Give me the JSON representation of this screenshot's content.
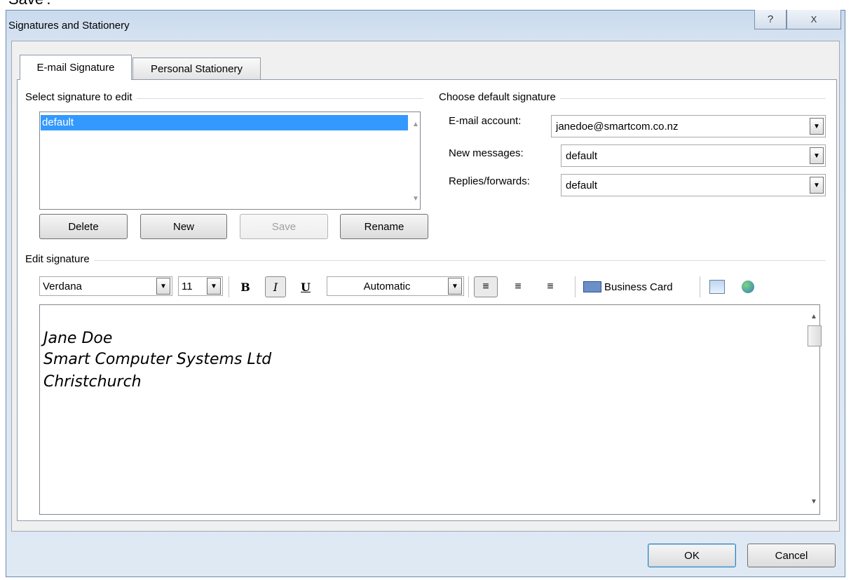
{
  "caption_fragment": "Save'.",
  "window": {
    "title": "Signatures and Stationery",
    "help_glyph": "?",
    "close_glyph": "X"
  },
  "tabs": [
    {
      "label": "E-mail Signature",
      "selected": true
    },
    {
      "label": "Personal Stationery",
      "selected": false
    }
  ],
  "select_signature": {
    "label": "Select signature to edit",
    "items": [
      {
        "label": "default",
        "selected": true
      }
    ]
  },
  "buttons": {
    "delete": "Delete",
    "new": "New",
    "save": "Save",
    "rename": "Rename"
  },
  "default_signature": {
    "label": "Choose default signature",
    "email_account": {
      "label": "E-mail account:",
      "value": "janedoe@smartcom.co.nz"
    },
    "new_messages": {
      "label": "New messages:",
      "value": "default"
    },
    "replies": {
      "label": "Replies/forwards:",
      "value": "default"
    }
  },
  "edit_signature": {
    "label": "Edit signature",
    "font": "Verdana",
    "size": "11",
    "bold": "B",
    "italic": "I",
    "underline": "U",
    "color": "Automatic",
    "business_card": "Business Card",
    "lines": [
      "Jane Doe",
      "Smart Computer Systems Ltd",
      "Christchurch"
    ]
  },
  "footer": {
    "ok": "OK",
    "cancel": "Cancel"
  }
}
